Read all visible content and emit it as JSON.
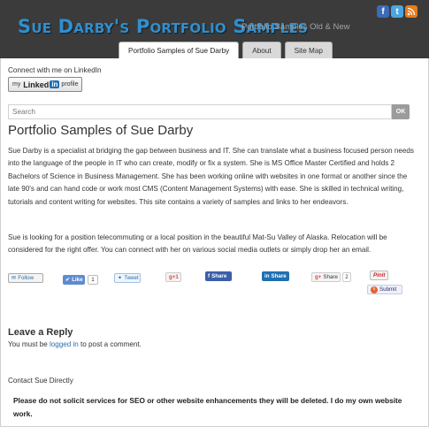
{
  "header": {
    "site_title": "Sue Darby's Portfolio Samples",
    "tagline": "Portfolio Samples Old & New",
    "social_icons": [
      "facebook-icon",
      "twitter-icon",
      "rss-icon"
    ]
  },
  "tabs": [
    {
      "label": "Portfolio Samples of Sue Darby",
      "active": true
    },
    {
      "label": "About",
      "active": false
    },
    {
      "label": "Site Map",
      "active": false
    }
  ],
  "linkedin": {
    "label": "Connect with me on LinkedIn",
    "badge_my": "my",
    "badge_linked": "Linked",
    "badge_in": "in",
    "badge_profile": "profile"
  },
  "search": {
    "placeholder": "Search",
    "button_label": "OK"
  },
  "page": {
    "title": "Portfolio Samples of Sue Darby",
    "paragraph_1": "Sue Darby is a specialist at bridging the gap between business and IT. She can translate what a business focused person needs into the language of the people in IT who can create, modify or fix a system. She is MS Office Master Certified and holds 2 Bachelors of Science in Business Management. She has been working online with websites in one format or another since the late 90's and can hand code or work most CMS (Content Management Systems) with ease. She is skilled in technical writing, tutorials and content writing for websites. This site contains a variety of samples and links to her endeavors.",
    "paragraph_2": "Sue is looking for a position telecommuting or a local position in the beautiful Mat-Su Valley of Alaska. Relocation will be considered for the right offer. You can connect with her on various social media outlets or simply drop her an email."
  },
  "share": {
    "follow": "Follow",
    "like": "Like",
    "like_count": "1",
    "tweet": "Tweet",
    "gplus": "g+1",
    "fb_share": "Share",
    "in_share": "Share",
    "g_share": "Share",
    "g_share_count": "2",
    "pin": "Pinit",
    "submit": "Submit"
  },
  "reply": {
    "title": "Leave a Reply",
    "prefix": "You must be ",
    "link": "logged in",
    "suffix": " to post a comment."
  },
  "contact": {
    "heading": "Contact Sue Directly",
    "notice": "Please do not solicit services for SEO or other website enhancements they will be deleted. I do my own website work."
  },
  "colors": {
    "header_bg": "#3b3b3b",
    "title": "#2f8fd0",
    "link": "#2b6fa8"
  }
}
